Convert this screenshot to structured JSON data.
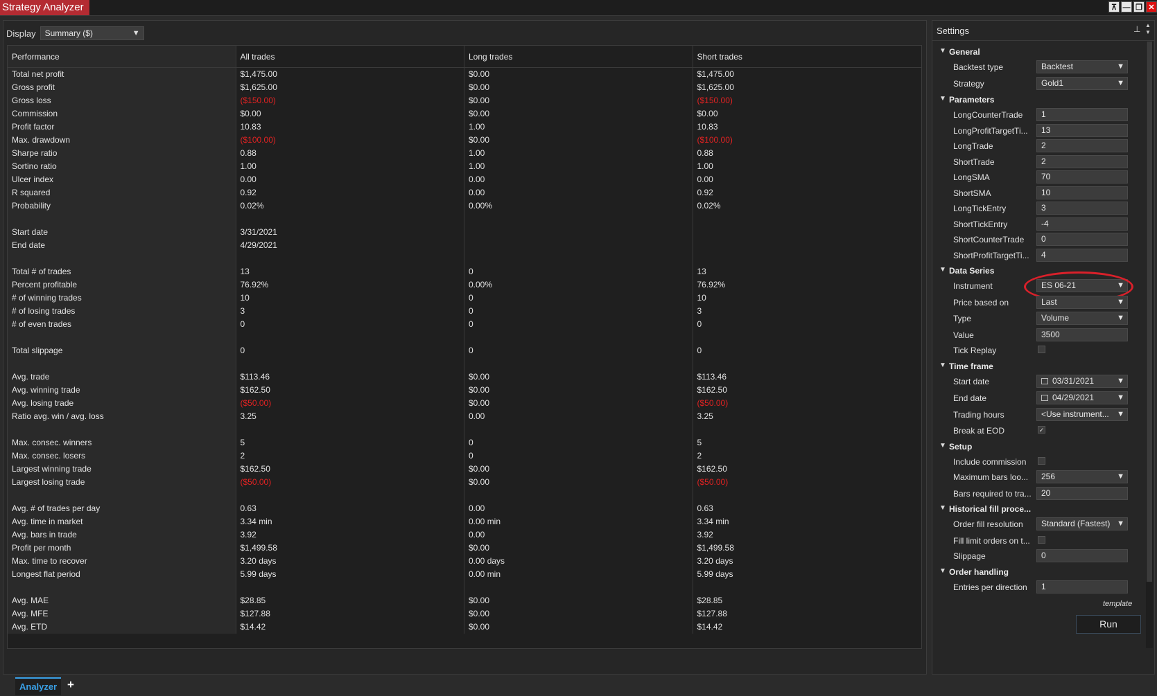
{
  "window": {
    "title": "Strategy Analyzer"
  },
  "display": {
    "label": "Display",
    "value": "Summary ($)"
  },
  "grid": {
    "headers": [
      "Performance",
      "All trades",
      "Long trades",
      "Short trades"
    ],
    "rows": [
      {
        "label": "Total net profit",
        "all": "$1,475.00",
        "long": "$0.00",
        "short": "$1,475.00"
      },
      {
        "label": "Gross profit",
        "all": "$1,625.00",
        "long": "$0.00",
        "short": "$1,625.00"
      },
      {
        "label": "Gross loss",
        "all": "($150.00)",
        "long": "$0.00",
        "short": "($150.00)",
        "neg": true
      },
      {
        "label": "Commission",
        "all": "$0.00",
        "long": "$0.00",
        "short": "$0.00"
      },
      {
        "label": "Profit factor",
        "all": "10.83",
        "long": "1.00",
        "short": "10.83"
      },
      {
        "label": "Max. drawdown",
        "all": "($100.00)",
        "long": "$0.00",
        "short": "($100.00)",
        "neg": true
      },
      {
        "label": "Sharpe ratio",
        "all": "0.88",
        "long": "1.00",
        "short": "0.88"
      },
      {
        "label": "Sortino ratio",
        "all": "1.00",
        "long": "1.00",
        "short": "1.00"
      },
      {
        "label": "Ulcer index",
        "all": "0.00",
        "long": "0.00",
        "short": "0.00"
      },
      {
        "label": "R squared",
        "all": "0.92",
        "long": "0.00",
        "short": "0.92"
      },
      {
        "label": "Probability",
        "all": "0.02%",
        "long": "0.00%",
        "short": "0.02%"
      },
      {
        "label": "",
        "all": "",
        "long": "",
        "short": ""
      },
      {
        "label": "Start date",
        "all": "3/31/2021",
        "long": "",
        "short": ""
      },
      {
        "label": "End date",
        "all": "4/29/2021",
        "long": "",
        "short": ""
      },
      {
        "label": "",
        "all": "",
        "long": "",
        "short": ""
      },
      {
        "label": "Total # of trades",
        "all": "13",
        "long": "0",
        "short": "13"
      },
      {
        "label": "Percent profitable",
        "all": "76.92%",
        "long": "0.00%",
        "short": "76.92%"
      },
      {
        "label": "# of winning trades",
        "all": "10",
        "long": "0",
        "short": "10"
      },
      {
        "label": "# of losing trades",
        "all": "3",
        "long": "0",
        "short": "3"
      },
      {
        "label": "# of even trades",
        "all": "0",
        "long": "0",
        "short": "0"
      },
      {
        "label": "",
        "all": "",
        "long": "",
        "short": ""
      },
      {
        "label": "Total slippage",
        "all": "0",
        "long": "0",
        "short": "0"
      },
      {
        "label": "",
        "all": "",
        "long": "",
        "short": ""
      },
      {
        "label": "Avg. trade",
        "all": "$113.46",
        "long": "$0.00",
        "short": "$113.46"
      },
      {
        "label": "Avg. winning trade",
        "all": "$162.50",
        "long": "$0.00",
        "short": "$162.50"
      },
      {
        "label": "Avg. losing trade",
        "all": "($50.00)",
        "long": "$0.00",
        "short": "($50.00)",
        "neg": true
      },
      {
        "label": "Ratio avg. win / avg. loss",
        "all": "3.25",
        "long": "0.00",
        "short": "3.25"
      },
      {
        "label": "",
        "all": "",
        "long": "",
        "short": ""
      },
      {
        "label": "Max. consec. winners",
        "all": "5",
        "long": "0",
        "short": "5"
      },
      {
        "label": "Max. consec. losers",
        "all": "2",
        "long": "0",
        "short": "2"
      },
      {
        "label": "Largest winning trade",
        "all": "$162.50",
        "long": "$0.00",
        "short": "$162.50"
      },
      {
        "label": "Largest losing trade",
        "all": "($50.00)",
        "long": "$0.00",
        "short": "($50.00)",
        "neg": true
      },
      {
        "label": "",
        "all": "",
        "long": "",
        "short": ""
      },
      {
        "label": "Avg. # of trades per day",
        "all": "0.63",
        "long": "0.00",
        "short": "0.63"
      },
      {
        "label": "Avg. time in market",
        "all": "3.34 min",
        "long": "0.00 min",
        "short": "3.34 min"
      },
      {
        "label": "Avg. bars in trade",
        "all": "3.92",
        "long": "0.00",
        "short": "3.92"
      },
      {
        "label": "Profit per month",
        "all": "$1,499.58",
        "long": "$0.00",
        "short": "$1,499.58"
      },
      {
        "label": "Max. time to recover",
        "all": "3.20 days",
        "long": "0.00 days",
        "short": "3.20 days"
      },
      {
        "label": "Longest flat period",
        "all": "5.99 days",
        "long": "0.00 min",
        "short": "5.99 days"
      },
      {
        "label": "",
        "all": "",
        "long": "",
        "short": ""
      },
      {
        "label": "Avg. MAE",
        "all": "$28.85",
        "long": "$0.00",
        "short": "$28.85"
      },
      {
        "label": "Avg. MFE",
        "all": "$127.88",
        "long": "$0.00",
        "short": "$127.88"
      },
      {
        "label": "Avg. ETD",
        "all": "$14.42",
        "long": "$0.00",
        "short": "$14.42"
      }
    ]
  },
  "tabs": {
    "active": "Analyzer",
    "add": "+"
  },
  "settings": {
    "title": "Settings",
    "template_label": "template",
    "run_label": "Run",
    "items": [
      {
        "kind": "cat",
        "text": "General"
      },
      {
        "kind": "dd",
        "label": "Backtest type",
        "value": "Backtest"
      },
      {
        "kind": "dd",
        "label": "Strategy",
        "value": "Gold1"
      },
      {
        "kind": "cat",
        "text": "Parameters"
      },
      {
        "kind": "txt",
        "label": "LongCounterTrade",
        "value": "1"
      },
      {
        "kind": "txt",
        "label": "LongProfitTargetTi...",
        "value": "13"
      },
      {
        "kind": "txt",
        "label": "LongTrade",
        "value": "2"
      },
      {
        "kind": "txt",
        "label": "ShortTrade",
        "value": "2"
      },
      {
        "kind": "txt",
        "label": "LongSMA",
        "value": "70"
      },
      {
        "kind": "txt",
        "label": "ShortSMA",
        "value": "10"
      },
      {
        "kind": "txt",
        "label": "LongTickEntry",
        "value": "3"
      },
      {
        "kind": "txt",
        "label": "ShortTickEntry",
        "value": "-4"
      },
      {
        "kind": "txt",
        "label": "ShortCounterTrade",
        "value": "0"
      },
      {
        "kind": "txt",
        "label": "ShortProfitTargetTi...",
        "value": "4"
      },
      {
        "kind": "cat",
        "text": "Data Series"
      },
      {
        "kind": "dd",
        "label": "Instrument",
        "value": "ES 06-21",
        "annotated": true
      },
      {
        "kind": "dd",
        "label": "Price based on",
        "value": "Last"
      },
      {
        "kind": "dd",
        "label": "Type",
        "value": "Volume"
      },
      {
        "kind": "txt",
        "label": "Value",
        "value": "3500"
      },
      {
        "kind": "chk",
        "label": "Tick Replay",
        "checked": false
      },
      {
        "kind": "cat",
        "text": "Time frame"
      },
      {
        "kind": "date",
        "label": "Start date",
        "value": "03/31/2021"
      },
      {
        "kind": "date",
        "label": "End date",
        "value": "04/29/2021"
      },
      {
        "kind": "dd",
        "label": "Trading hours",
        "value": "<Use instrument..."
      },
      {
        "kind": "chk",
        "label": "Break at EOD",
        "checked": true
      },
      {
        "kind": "cat",
        "text": "Setup"
      },
      {
        "kind": "chk",
        "label": "Include commission",
        "checked": false
      },
      {
        "kind": "dd",
        "label": "Maximum bars loo...",
        "value": "256"
      },
      {
        "kind": "txt",
        "label": "Bars required to tra...",
        "value": "20"
      },
      {
        "kind": "cat",
        "text": "Historical fill proce..."
      },
      {
        "kind": "dd",
        "label": "Order fill resolution",
        "value": "Standard (Fastest)"
      },
      {
        "kind": "chk",
        "label": "Fill limit orders on t...",
        "checked": false
      },
      {
        "kind": "txt",
        "label": "Slippage",
        "value": "0"
      },
      {
        "kind": "cat",
        "text": "Order handling"
      },
      {
        "kind": "txt",
        "label": "Entries per direction",
        "value": "1"
      }
    ]
  }
}
